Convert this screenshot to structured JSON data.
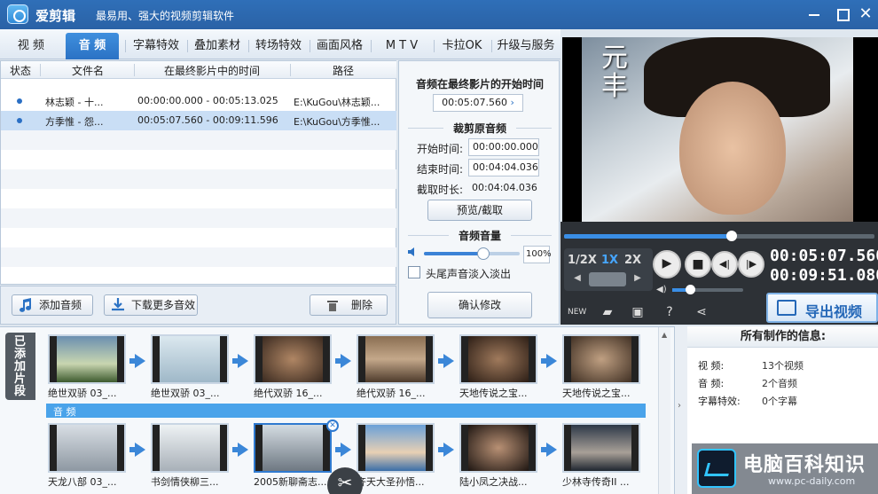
{
  "app": {
    "name": "爱剪辑",
    "slogan": "最易用、强大的视频剪辑软件"
  },
  "tabs": [
    {
      "label": "视  频",
      "active": false
    },
    {
      "label": "音  频",
      "active": true
    },
    {
      "label": "字幕特效",
      "active": false
    },
    {
      "label": "叠加素材",
      "active": false
    },
    {
      "label": "转场特效",
      "active": false
    },
    {
      "label": "画面风格",
      "active": false
    },
    {
      "label": "M T V",
      "active": false
    },
    {
      "label": "卡拉OK",
      "active": false
    },
    {
      "label": "升级与服务",
      "active": false
    }
  ],
  "audio_list": {
    "headers": [
      "状态",
      "文件名",
      "在最终影片中的时间",
      "路径"
    ],
    "rows": [
      {
        "filename": "林志颖 - 十...",
        "time": "00:00:00.000 - 00:05:13.025",
        "path": "E:\\KuGou\\林志颖...",
        "selected": false
      },
      {
        "filename": "方季惟 - 怨...",
        "time": "00:05:07.560 - 00:09:11.596",
        "path": "E:\\KuGou\\方季惟...",
        "selected": true
      }
    ],
    "buttons": {
      "add_audio": "添加音频",
      "download_effects": "下载更多音效",
      "delete": "删除"
    }
  },
  "settings": {
    "start_title": "音频在最终影片的开始时间",
    "start_value": "00:05:07.560",
    "trim_title": "裁剪原音频",
    "start_label": "开始时间:",
    "start_time": "00:00:00.000",
    "end_label": "结束时间:",
    "end_time": "00:04:04.036",
    "duration_label": "截取时长:",
    "duration": "00:04:04.036",
    "preview_button": "预览/截取",
    "volume_title": "音频音量",
    "volume_value": "100%",
    "volume_level": 0.62,
    "fade_label": "头尾声音淡入淡出",
    "confirm_button": "确认修改"
  },
  "preview": {
    "caption": "元丰",
    "progress": 0.54,
    "speeds": [
      {
        "label": "1/2X",
        "active": false
      },
      {
        "label": "1X",
        "active": true
      },
      {
        "label": "2X",
        "active": false
      }
    ],
    "current_time": "00:05:07.560",
    "total_time": "00:09:51.080",
    "player_volume": 0.25,
    "export_label": "导出视频"
  },
  "timeline": {
    "added_tab": "已添加片段",
    "audio_track_label": "音  频",
    "video_clips": [
      "绝世双骄 03_...",
      "绝世双骄 03_...",
      "绝代双骄 16_...",
      "绝代双骄 16_...",
      "天地传说之宝...",
      "天地传说之宝..."
    ],
    "audio_clips": [
      "天龙八部 03_...",
      "书剑情侠柳三...",
      "2005新聊斋志...",
      "齐天大圣孙悟...",
      "陆小凤之决战...",
      "少林寺传奇II ..."
    ],
    "selected_audio_clip": 2
  },
  "info": {
    "title": "所有制作的信息:",
    "rows": [
      {
        "label": "视    频:",
        "value": "13个视频"
      },
      {
        "label": "音    频:",
        "value": "2个音频"
      },
      {
        "label": "字幕特效:",
        "value": "0个字幕"
      }
    ]
  },
  "watermark": {
    "text": "电脑百科知识",
    "url": "www.pc-daily.com"
  },
  "colors": {
    "accent": "#2b72c4",
    "titlebar": "#2f6fb8",
    "selection": "#c9def5",
    "player_bg": "#2d3136"
  }
}
